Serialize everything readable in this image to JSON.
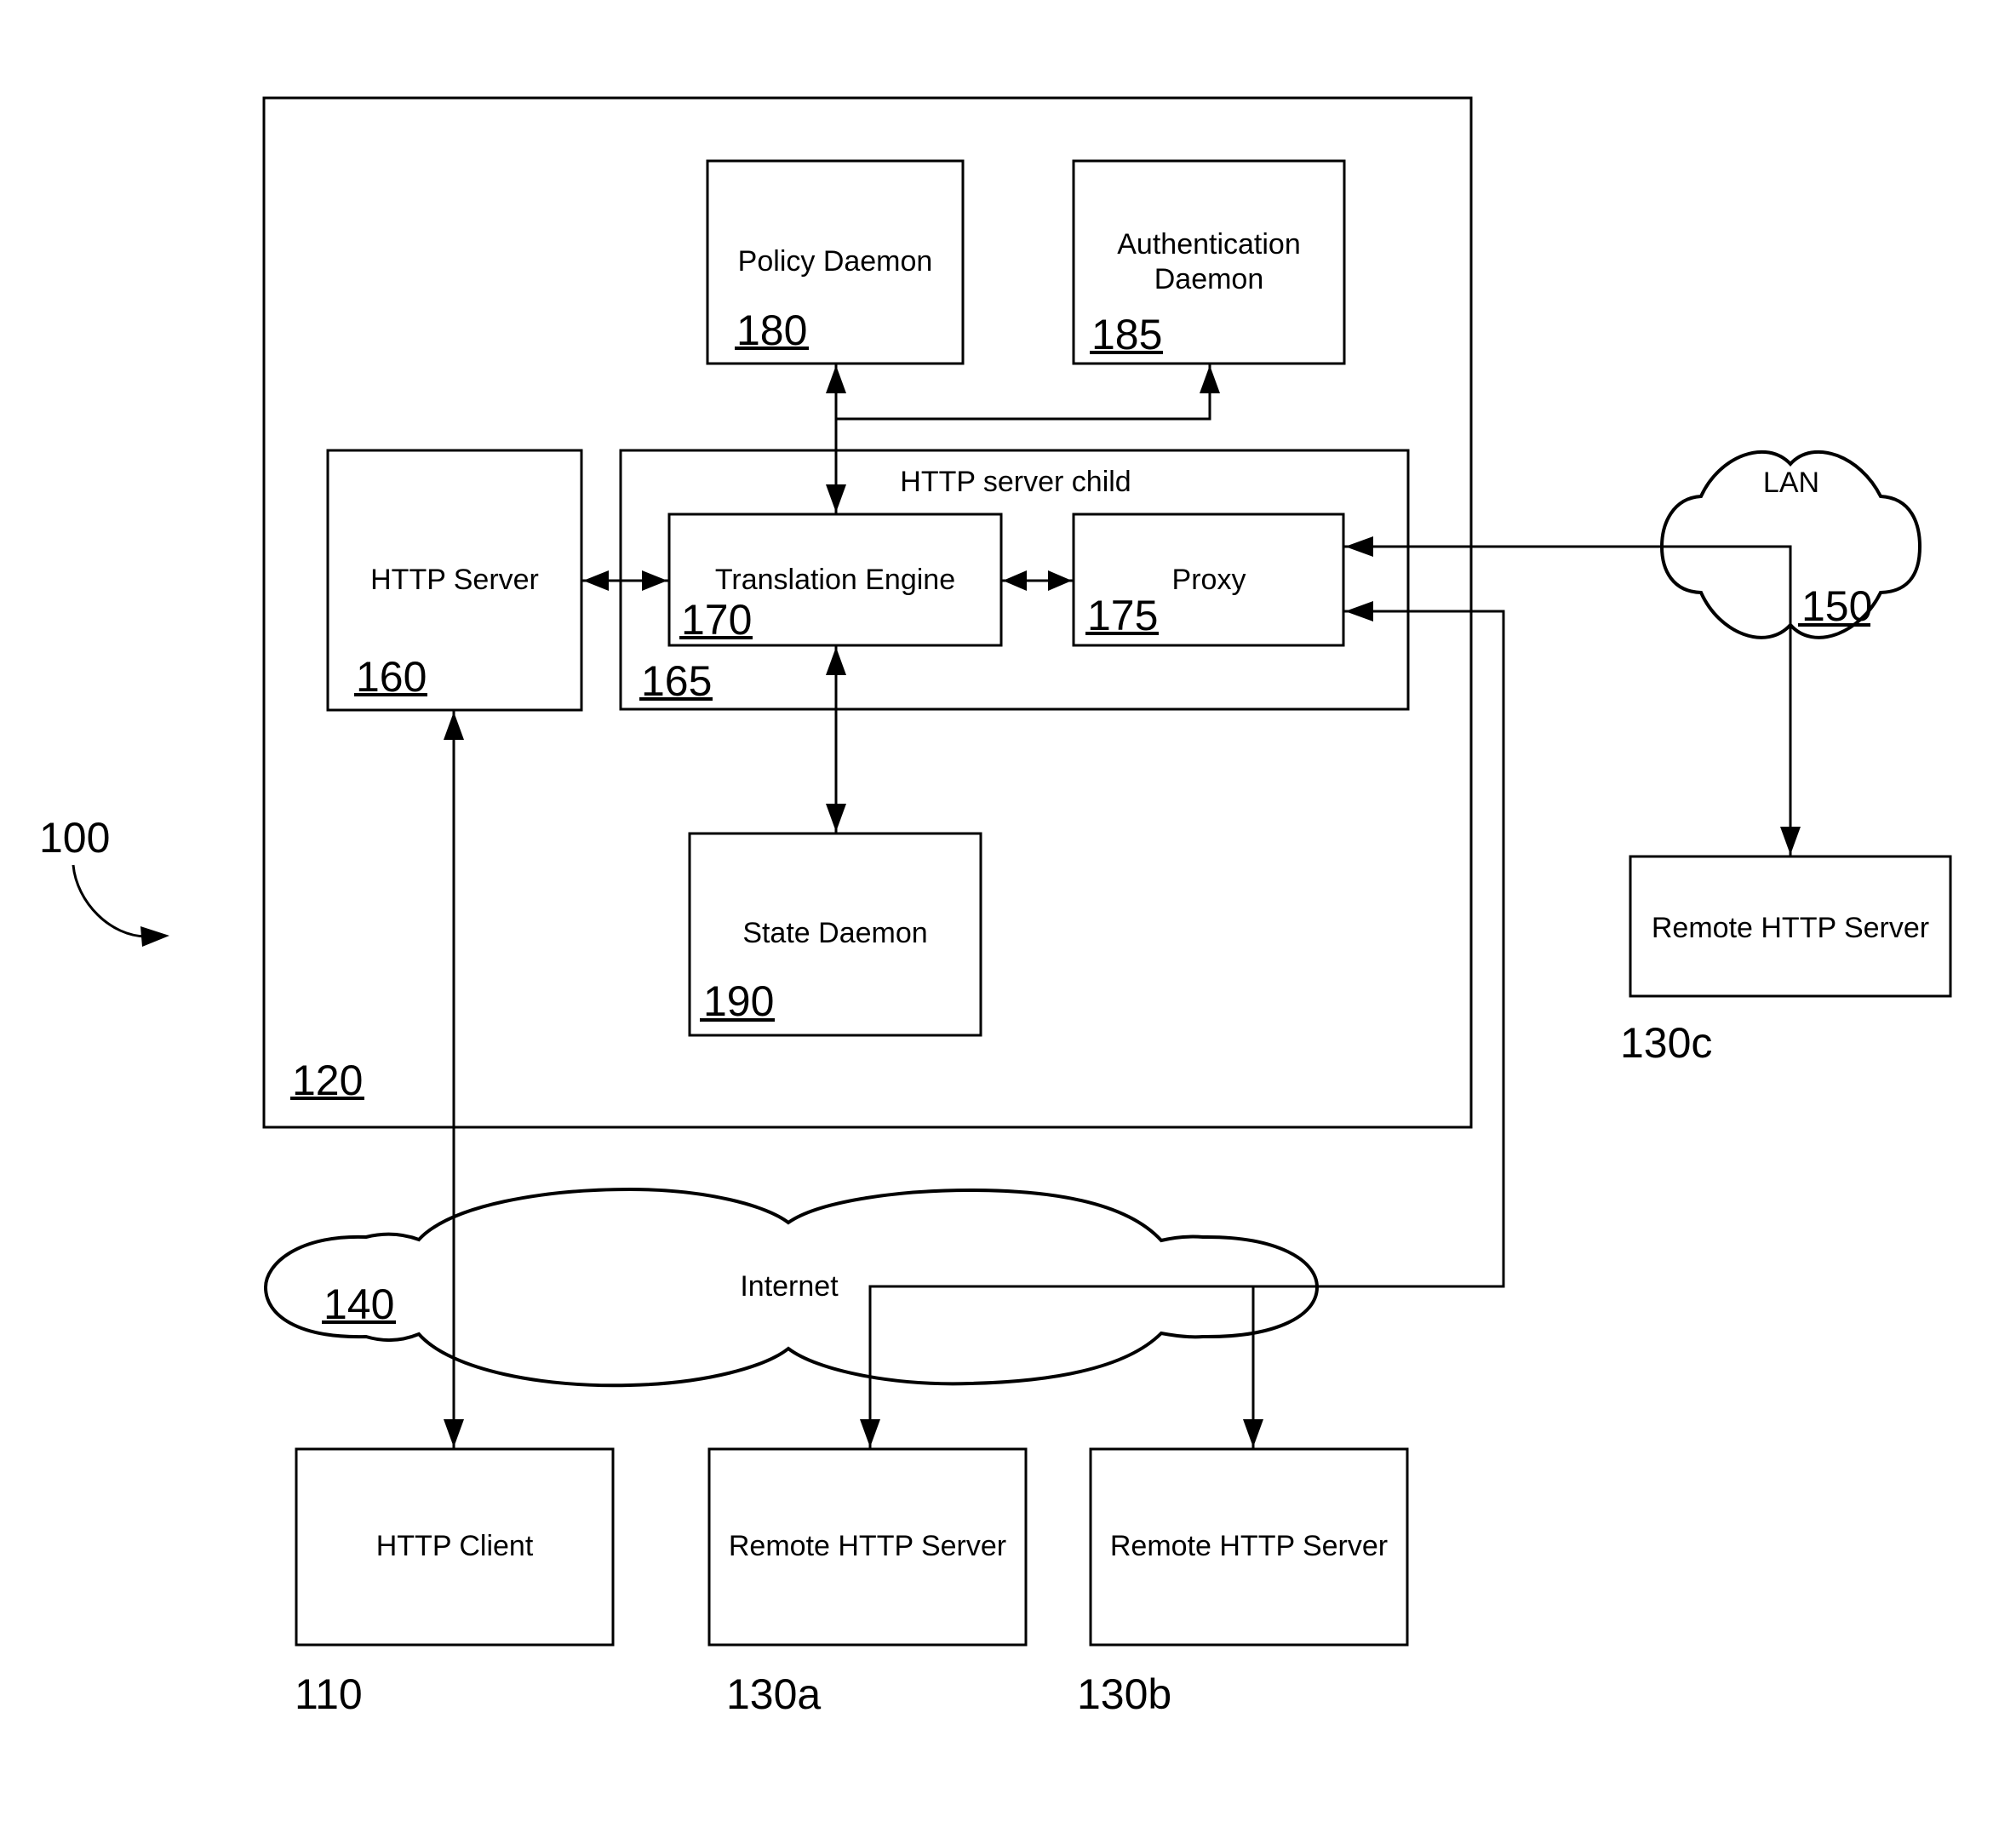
{
  "figure": {
    "system_ref": "100",
    "proxy_server": {
      "ref": "120"
    },
    "http_server": {
      "label": "HTTP Server",
      "ref": "160"
    },
    "server_child": {
      "label": "HTTP server child",
      "ref": "165"
    },
    "translation_engine": {
      "label": "Translation Engine",
      "ref": "170"
    },
    "proxy": {
      "label": "Proxy",
      "ref": "175"
    },
    "policy_daemon": {
      "label": "Policy Daemon",
      "ref": "180"
    },
    "auth_daemon": {
      "label_line1": "Authentication",
      "label_line2": "Daemon",
      "ref": "185"
    },
    "state_daemon": {
      "label": "State Daemon",
      "ref": "190"
    },
    "internet": {
      "label": "Internet",
      "ref": "140"
    },
    "lan": {
      "label": "LAN",
      "ref": "150"
    },
    "http_client": {
      "label": "HTTP Client",
      "ref": "110"
    },
    "remote_a": {
      "label": "Remote HTTP Server",
      "ref": "130a"
    },
    "remote_b": {
      "label": "Remote HTTP Server",
      "ref": "130b"
    },
    "remote_c": {
      "label": "Remote HTTP Server",
      "ref": "130c"
    }
  },
  "connections": [
    {
      "from": "HTTP Server",
      "to": "Translation Engine",
      "direction": "bidirectional"
    },
    {
      "from": "Translation Engine",
      "to": "Proxy",
      "direction": "bidirectional"
    },
    {
      "from": "Translation Engine",
      "to": "Policy Daemon",
      "direction": "bidirectional"
    },
    {
      "from": "Translation Engine",
      "to": "Authentication Daemon",
      "direction": "to"
    },
    {
      "from": "Translation Engine",
      "to": "State Daemon",
      "direction": "bidirectional"
    },
    {
      "from": "HTTP Server",
      "to": "HTTP Client",
      "direction": "bidirectional",
      "via": "Internet"
    },
    {
      "from": "Proxy",
      "to": "Remote HTTP Server 130a",
      "direction": "bidirectional",
      "via": "Internet"
    },
    {
      "from": "Proxy",
      "to": "Remote HTTP Server 130b",
      "direction": "bidirectional",
      "via": "Internet"
    },
    {
      "from": "Proxy",
      "to": "Remote HTTP Server 130c",
      "direction": "bidirectional",
      "via": "LAN"
    }
  ]
}
